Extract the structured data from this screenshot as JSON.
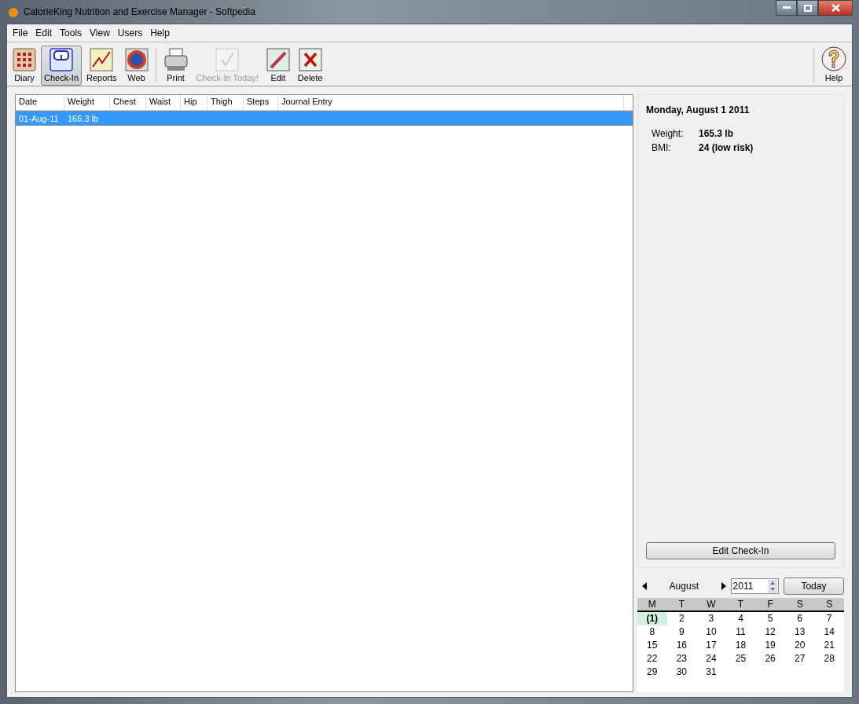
{
  "window": {
    "title": "CalorieKing Nutrition and Exercise Manager - Softpedia"
  },
  "menu": [
    "File",
    "Edit",
    "Tools",
    "View",
    "Users",
    "Help"
  ],
  "toolbar": [
    {
      "label": "Diary",
      "kind": "diary",
      "selected": false,
      "disabled": false
    },
    {
      "label": "Check-In",
      "kind": "scale",
      "selected": true,
      "disabled": false
    },
    {
      "label": "Reports",
      "kind": "chart",
      "selected": false,
      "disabled": false
    },
    {
      "label": "Web",
      "kind": "globe",
      "selected": false,
      "disabled": false
    },
    {
      "label": "Print",
      "kind": "printer",
      "selected": false,
      "disabled": false
    },
    {
      "label": "Check-In Today!",
      "kind": "check",
      "selected": false,
      "disabled": true
    },
    {
      "label": "Edit",
      "kind": "pen",
      "selected": false,
      "disabled": false
    },
    {
      "label": "Delete",
      "kind": "cross",
      "selected": false,
      "disabled": false
    }
  ],
  "help_button": {
    "label": "Help"
  },
  "table": {
    "columns": [
      "Date",
      "Weight",
      "Chest",
      "Waist",
      "Hip",
      "Thigh",
      "Steps",
      "Journal Entry"
    ],
    "rows": [
      {
        "cells": [
          "01-Aug-11",
          "165.3 lb"
        ],
        "selected": true
      }
    ]
  },
  "details": {
    "heading": "Monday, August 1 2011",
    "fields": [
      {
        "label": "Weight:",
        "value": "165.3 lb"
      },
      {
        "label": "BMI:",
        "value": "24 (low risk)"
      }
    ],
    "button": "Edit Check-In"
  },
  "calendar": {
    "month": "August",
    "year": "2011",
    "today_button": "Today",
    "weekdays": [
      "M",
      "T",
      "W",
      "T",
      "F",
      "S",
      "S"
    ],
    "days": [
      {
        "label": "(1)",
        "selected": true
      },
      {
        "label": "2",
        "selected": false
      },
      {
        "label": "3",
        "selected": false
      },
      {
        "label": "4",
        "selected": false
      },
      {
        "label": "5",
        "selected": false
      },
      {
        "label": "6",
        "selected": false
      },
      {
        "label": "7",
        "selected": false
      },
      {
        "label": "8",
        "selected": false
      },
      {
        "label": "9",
        "selected": false
      },
      {
        "label": "10",
        "selected": false
      },
      {
        "label": "11",
        "selected": false
      },
      {
        "label": "12",
        "selected": false
      },
      {
        "label": "13",
        "selected": false
      },
      {
        "label": "14",
        "selected": false
      },
      {
        "label": "15",
        "selected": false
      },
      {
        "label": "16",
        "selected": false
      },
      {
        "label": "17",
        "selected": false
      },
      {
        "label": "18",
        "selected": false
      },
      {
        "label": "19",
        "selected": false
      },
      {
        "label": "20",
        "selected": false
      },
      {
        "label": "21",
        "selected": false
      },
      {
        "label": "22",
        "selected": false
      },
      {
        "label": "23",
        "selected": false
      },
      {
        "label": "24",
        "selected": false
      },
      {
        "label": "25",
        "selected": false
      },
      {
        "label": "26",
        "selected": false
      },
      {
        "label": "27",
        "selected": false
      },
      {
        "label": "28",
        "selected": false
      },
      {
        "label": "29",
        "selected": false
      },
      {
        "label": "30",
        "selected": false
      },
      {
        "label": "31",
        "selected": false
      }
    ]
  }
}
